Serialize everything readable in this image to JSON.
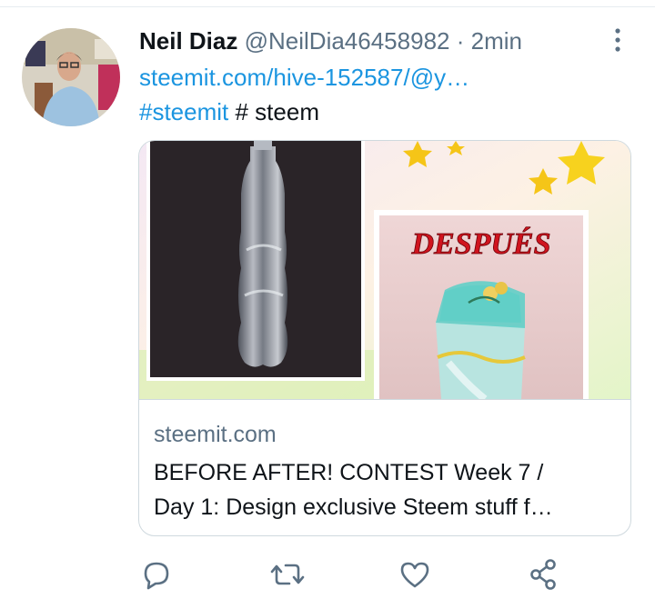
{
  "tweet": {
    "display_name": "Neil Diaz",
    "handle": "@NeilDia46458982",
    "separator": "·",
    "timestamp": "2min",
    "link_text": "steemit.com/hive-152587/@y…",
    "hashtag": "#steemit",
    "extra_text": "# steem"
  },
  "card": {
    "image_label": "DESPUÉS",
    "domain": "steemit.com",
    "title_line1": "BEFORE AFTER! CONTEST Week 7 /",
    "title_line2": "Day 1: Design exclusive Steem stuff f…"
  },
  "icons": {
    "more": "more-vertical-icon",
    "reply": "reply-icon",
    "retweet": "retweet-icon",
    "like": "heart-icon",
    "share": "share-icon"
  },
  "colors": {
    "link": "#1b95e0",
    "muted": "#5b7083",
    "text": "#0f1419",
    "border": "#cfd9de"
  }
}
